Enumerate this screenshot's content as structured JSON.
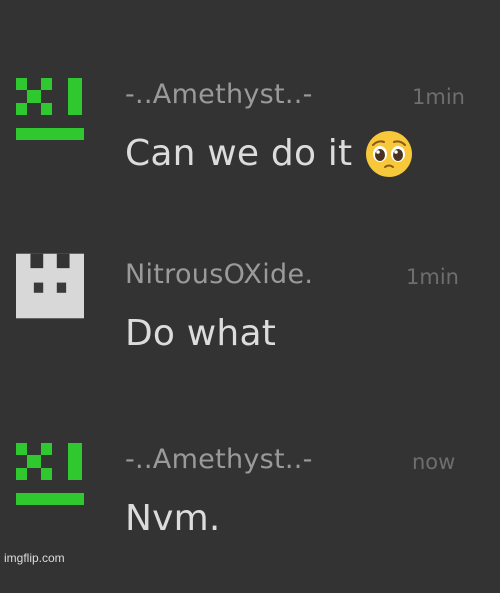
{
  "messages": [
    {
      "username": "-..Amethyst..-",
      "timestamp": "1min",
      "text": "Can we do it",
      "avatar_icon": "green-xi-icon",
      "emoji": "pleading-face-emoji"
    },
    {
      "username": "NitrousOXide.",
      "timestamp": "1min",
      "text": "Do what",
      "avatar_icon": "white-cat-icon"
    },
    {
      "username": "-..Amethyst..-",
      "timestamp": "now",
      "text": "Nvm.",
      "avatar_icon": "green-xi-icon"
    }
  ],
  "watermark": "imgflip.com",
  "colors": {
    "background": "#333333",
    "username": "#9a9a9a",
    "timestamp": "#6e6e6e",
    "message_text": "#dcdcdc",
    "avatar_green": "#2fc92f",
    "avatar_white": "#d8d8d8"
  }
}
